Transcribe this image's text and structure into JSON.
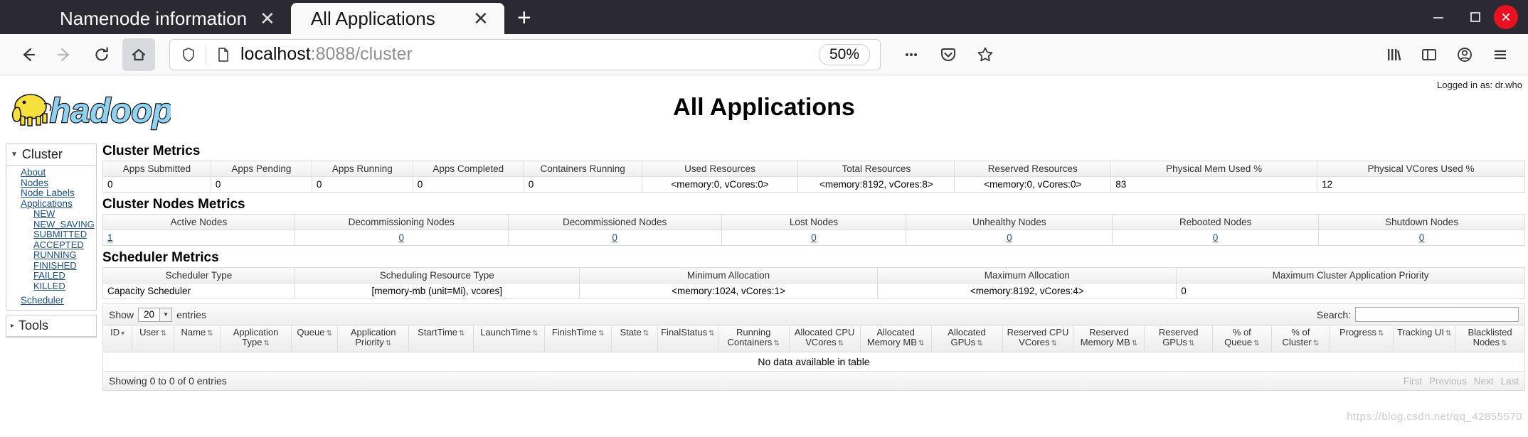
{
  "browser": {
    "tabs": [
      {
        "title": "Namenode information",
        "active": false,
        "close_label": "✕"
      },
      {
        "title": "All Applications",
        "active": true,
        "close_label": "✕"
      }
    ],
    "new_tab_label": "+",
    "window_controls": {
      "minimize": "─",
      "maximize": "☐",
      "close": "✕"
    },
    "nav": {
      "back": "back-arrow",
      "forward": "forward-arrow",
      "reload": "reload-arrow",
      "home": "home-icon"
    },
    "url": {
      "host": "localhost",
      "port": ":8088",
      "path": "/cluster"
    },
    "zoom_level": "50%",
    "toolbar_icons": [
      "ellipsis",
      "pocket",
      "star",
      "library",
      "sidebar",
      "account",
      "menu"
    ]
  },
  "page": {
    "logged_in_as": "Logged in as: dr.who",
    "logo_text": "hadoop",
    "title": "All Applications",
    "watermark": "https://blog.csdn.net/qq_42855570"
  },
  "sidebar": {
    "cluster": {
      "header": "Cluster",
      "links": [
        "About",
        "Nodes",
        "Node Labels",
        "Applications"
      ],
      "states": [
        "NEW",
        "NEW_SAVING",
        "SUBMITTED",
        "ACCEPTED",
        "RUNNING",
        "FINISHED",
        "FAILED",
        "KILLED"
      ],
      "scheduler": "Scheduler"
    },
    "tools": {
      "header": "Tools"
    }
  },
  "cluster_metrics": {
    "title": "Cluster Metrics",
    "headers": [
      "Apps Submitted",
      "Apps Pending",
      "Apps Running",
      "Apps Completed",
      "Containers Running",
      "Used Resources",
      "Total Resources",
      "Reserved Resources",
      "Physical Mem Used %",
      "Physical VCores Used %"
    ],
    "values": [
      "0",
      "0",
      "0",
      "0",
      "0",
      "<memory:0, vCores:0>",
      "<memory:8192, vCores:8>",
      "<memory:0, vCores:0>",
      "83",
      "12"
    ]
  },
  "node_metrics": {
    "title": "Cluster Nodes Metrics",
    "headers": [
      "Active Nodes",
      "Decommissioning Nodes",
      "Decommissioned Nodes",
      "Lost Nodes",
      "Unhealthy Nodes",
      "Rebooted Nodes",
      "Shutdown Nodes"
    ],
    "values": [
      "1",
      "0",
      "0",
      "0",
      "0",
      "0",
      "0"
    ]
  },
  "scheduler_metrics": {
    "title": "Scheduler Metrics",
    "headers": [
      "Scheduler Type",
      "Scheduling Resource Type",
      "Minimum Allocation",
      "Maximum Allocation",
      "Maximum Cluster Application Priority"
    ],
    "values": [
      "Capacity Scheduler",
      "[memory-mb (unit=Mi), vcores]",
      "<memory:1024, vCores:1>",
      "<memory:8192, vCores:4>",
      "0"
    ]
  },
  "apps_table": {
    "show_label": "Show",
    "entries_count": "20",
    "entries_label": "entries",
    "search_label": "Search:",
    "search_value": "",
    "columns": [
      {
        "label": "ID",
        "sort": "▾"
      },
      {
        "label": "User",
        "sort": "⇅"
      },
      {
        "label": "Name",
        "sort": "⇅"
      },
      {
        "label": "Application Type",
        "sort": "⇅"
      },
      {
        "label": "Queue",
        "sort": "⇅"
      },
      {
        "label": "Application Priority",
        "sort": "⇅"
      },
      {
        "label": "StartTime",
        "sort": "⇅"
      },
      {
        "label": "LaunchTime",
        "sort": "⇅"
      },
      {
        "label": "FinishTime",
        "sort": "⇅"
      },
      {
        "label": "State",
        "sort": "⇅"
      },
      {
        "label": "FinalStatus",
        "sort": "⇅"
      },
      {
        "label": "Running Containers",
        "sort": "⇅"
      },
      {
        "label": "Allocated CPU VCores",
        "sort": "⇅"
      },
      {
        "label": "Allocated Memory MB",
        "sort": "⇅"
      },
      {
        "label": "Allocated GPUs",
        "sort": "⇅"
      },
      {
        "label": "Reserved CPU VCores",
        "sort": "⇅"
      },
      {
        "label": "Reserved Memory MB",
        "sort": "⇅"
      },
      {
        "label": "Reserved GPUs",
        "sort": "⇅"
      },
      {
        "label": "% of Queue",
        "sort": "⇅"
      },
      {
        "label": "% of Cluster",
        "sort": "⇅"
      },
      {
        "label": "Progress",
        "sort": "⇅"
      },
      {
        "label": "Tracking UI",
        "sort": "⇅"
      },
      {
        "label": "Blacklisted Nodes",
        "sort": "⇅"
      }
    ],
    "empty_message": "No data available in table",
    "showing_text": "Showing 0 to 0 of 0 entries",
    "pager": [
      "First",
      "Previous",
      "Next",
      "Last"
    ]
  },
  "colors": {
    "link": "#1d4f91",
    "chrome_dark": "#2b2a33",
    "chrome_light": "#f9f9fa",
    "close_red": "#e81123",
    "logo_yellow": "#f7e03c",
    "logo_blue": "#8fd3f4"
  }
}
